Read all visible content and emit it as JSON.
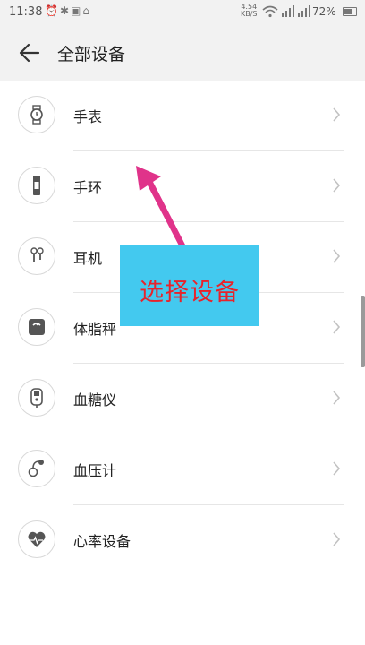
{
  "status_bar": {
    "time": "11:38",
    "speed_value": "4.54",
    "speed_unit": "KB/S",
    "signal_1": "4G",
    "signal_2": "4G",
    "battery": "72%"
  },
  "header": {
    "title": "全部设备"
  },
  "devices": [
    {
      "label": "手表",
      "icon": "watch-icon"
    },
    {
      "label": "手环",
      "icon": "band-icon"
    },
    {
      "label": "耳机",
      "icon": "earphone-icon"
    },
    {
      "label": "体脂秤",
      "icon": "scale-icon"
    },
    {
      "label": "血糖仪",
      "icon": "glucose-meter-icon"
    },
    {
      "label": "血压计",
      "icon": "blood-pressure-icon"
    },
    {
      "label": "心率设备",
      "icon": "heart-rate-icon"
    }
  ],
  "overlay": {
    "text": "选择设备"
  },
  "colors": {
    "overlay_bg": "#43c9ef",
    "overlay_text": "#e8232b",
    "arrow": "#e0338a"
  }
}
